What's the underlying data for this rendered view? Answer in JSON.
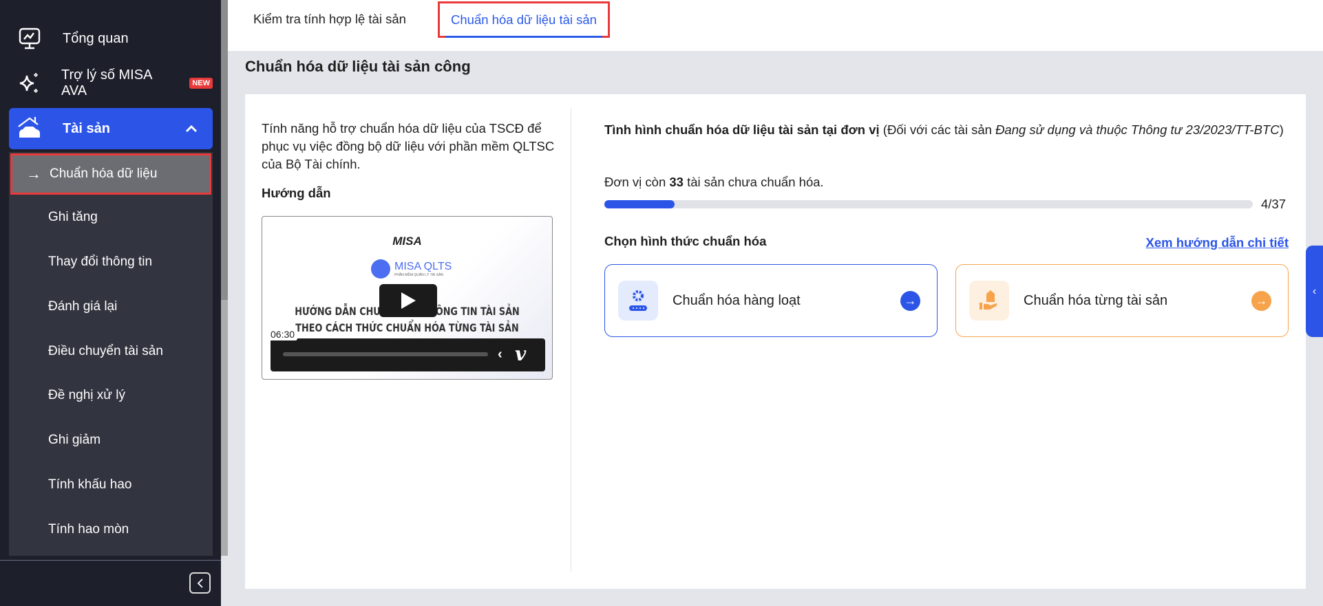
{
  "sidebar": {
    "items": [
      {
        "label": "Tổng quan",
        "icon": "monitor-chart-icon"
      },
      {
        "label": "Trợ lý số MISA AVA",
        "icon": "sparkle-icon",
        "badge": "NEW"
      },
      {
        "label": "Tài sản",
        "icon": "house-car-icon",
        "expanded": true
      }
    ],
    "submenu": [
      {
        "label": "Chuẩn hóa dữ liệu",
        "active": true
      },
      {
        "label": "Ghi tăng"
      },
      {
        "label": "Thay đổi thông tin"
      },
      {
        "label": "Đánh giá lại"
      },
      {
        "label": "Điều chuyển tài sản"
      },
      {
        "label": "Đề nghị xử lý"
      },
      {
        "label": "Ghi giảm"
      },
      {
        "label": "Tính khấu hao"
      },
      {
        "label": "Tính hao mòn"
      }
    ]
  },
  "tabs": [
    {
      "label": "Kiểm tra tính hợp lệ tài sản"
    },
    {
      "label": "Chuẩn hóa dữ liệu tài sản",
      "active": true
    }
  ],
  "page_title": "Chuẩn hóa dữ liệu tài sản công",
  "left": {
    "description": "Tính năng hỗ trợ chuẩn hóa dữ liệu của TSCĐ để phục vụ việc đồng bộ dữ liệu với phần mềm QLTSC của Bộ Tài chính.",
    "guide_label": "Hướng dẫn",
    "video": {
      "brand": "MISA",
      "product": "MISA QLTS",
      "product_sub": "PHẦN MỀM QUẢN LÝ TÀI SẢN",
      "title_line1": "HƯỚNG DẪN CHUẨN HÓA THÔNG TIN TÀI SẢN",
      "title_line2": "THEO CÁCH THỨC CHUẨN HÓA TỪNG TÀI SẢN",
      "duration": "06:30"
    }
  },
  "right": {
    "status_bold": "Tình hình chuẩn hóa dữ liệu tài sản tại đơn vị",
    "status_paren_open": " (Đối với các tài sản ",
    "status_italic": "Đang sử dụng và thuộc Thông tư 23/2023/TT-BTC",
    "status_paren_close": ")",
    "remaining_prefix": "Đơn vị còn ",
    "remaining_count": "33",
    "remaining_suffix": " tài sản chưa chuẩn hóa.",
    "progress_text": "4/37",
    "progress_fraction": 0.108,
    "choose_label": "Chọn hình thức chuẩn hóa",
    "guide_link": "Xem hướng dẫn chi tiết",
    "options": [
      {
        "label": "Chuẩn hóa hàng loạt",
        "icon": "gear-conveyor-icon",
        "color": "#2c55e8"
      },
      {
        "label": "Chuẩn hóa từng tài sản",
        "icon": "hand-tag-icon",
        "color": "#f7a34b"
      }
    ]
  },
  "colors": {
    "accent": "#2c55e8",
    "sidebar_bg": "#1d1f2b",
    "highlight_red": "#e93a3a"
  }
}
